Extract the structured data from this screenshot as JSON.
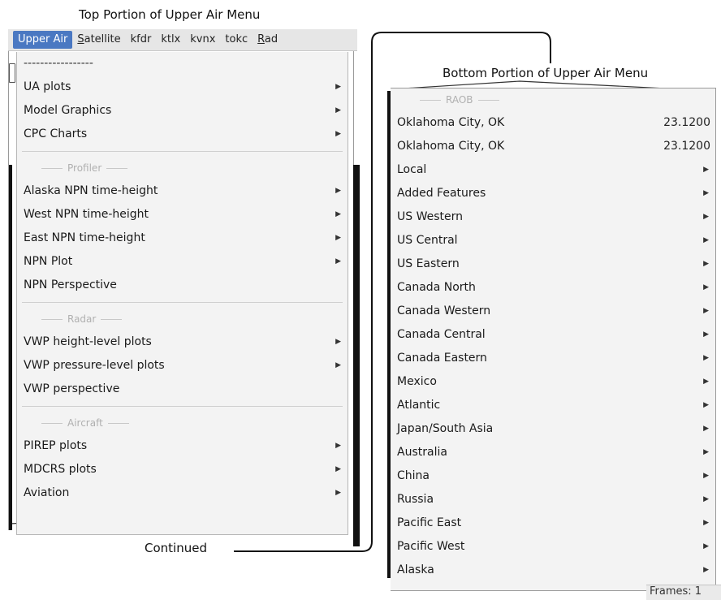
{
  "captions": {
    "top": "Top Portion of Upper Air Menu",
    "bottom": "Bottom Portion of Upper Air Menu",
    "continued": "Continued"
  },
  "menubar": {
    "items": [
      {
        "label": "Upper Air",
        "active": true
      },
      {
        "label": "Satellite",
        "mnemonic": "S"
      },
      {
        "label": "kfdr"
      },
      {
        "label": "ktlx"
      },
      {
        "label": "kvnx"
      },
      {
        "label": "tokc"
      },
      {
        "label": "Rad",
        "mnemonic": "R"
      }
    ]
  },
  "top_menu": {
    "tearoff": "-----------------",
    "items_a": [
      {
        "label": "UA plots",
        "submenu": true
      },
      {
        "label": "Model Graphics",
        "submenu": true
      },
      {
        "label": "CPC Charts",
        "submenu": true
      }
    ],
    "group_profiler": "Profiler",
    "items_b": [
      {
        "label": "Alaska NPN time-height",
        "submenu": true
      },
      {
        "label": "West NPN time-height",
        "submenu": true
      },
      {
        "label": "East NPN time-height",
        "submenu": true
      },
      {
        "label": "NPN Plot",
        "submenu": true
      },
      {
        "label": "NPN Perspective",
        "submenu": false
      }
    ],
    "group_radar": "Radar",
    "items_c": [
      {
        "label": "VWP height-level plots",
        "submenu": true
      },
      {
        "label": "VWP pressure-level plots",
        "submenu": true
      },
      {
        "label": "VWP perspective",
        "submenu": false
      }
    ],
    "group_aircraft": "Aircraft",
    "items_d": [
      {
        "label": "PIREP plots",
        "submenu": true
      },
      {
        "label": "MDCRS plots",
        "submenu": true
      },
      {
        "label": "Aviation",
        "submenu": true
      }
    ]
  },
  "bottom_menu": {
    "group_raob": "RAOB",
    "items": [
      {
        "label": "Oklahoma City, OK",
        "value": "23.1200"
      },
      {
        "label": "Oklahoma City, OK",
        "value": "23.1200"
      },
      {
        "label": "Local",
        "submenu": true
      },
      {
        "label": "Added Features",
        "submenu": true
      },
      {
        "label": "US Western",
        "submenu": true
      },
      {
        "label": "US Central",
        "submenu": true
      },
      {
        "label": "US Eastern",
        "submenu": true
      },
      {
        "label": "Canada North",
        "submenu": true
      },
      {
        "label": "Canada Western",
        "submenu": true
      },
      {
        "label": "Canada Central",
        "submenu": true
      },
      {
        "label": "Canada Eastern",
        "submenu": true
      },
      {
        "label": "Mexico",
        "submenu": true
      },
      {
        "label": "Atlantic",
        "submenu": true
      },
      {
        "label": "Japan/South Asia",
        "submenu": true
      },
      {
        "label": "Australia",
        "submenu": true
      },
      {
        "label": "China",
        "submenu": true
      },
      {
        "label": "Russia",
        "submenu": true
      },
      {
        "label": "Pacific East",
        "submenu": true
      },
      {
        "label": "Pacific West",
        "submenu": true
      },
      {
        "label": "Alaska",
        "submenu": true
      }
    ]
  },
  "status": {
    "frames": "Frames: 1"
  },
  "icons": {
    "submenu_arrow": "triangle-right-icon",
    "submenu_glyph": "▶"
  }
}
